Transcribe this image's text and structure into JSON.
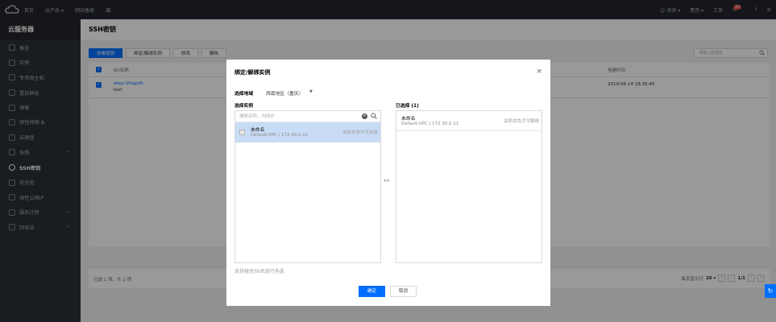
{
  "topbar": {
    "nav": [
      "首页",
      "云产品 ▾",
      "网站备案"
    ],
    "right": [
      "添添 ▾",
      "费用 ▾",
      "工单"
    ],
    "badge": "31"
  },
  "sidebar": {
    "title": "云服务器",
    "items": [
      {
        "label": "概览"
      },
      {
        "label": "实例"
      },
      {
        "label": "专用宿主机"
      },
      {
        "label": "置放群组"
      },
      {
        "label": "镜像"
      },
      {
        "label": "弹性伸缩 ⧉"
      },
      {
        "label": "云硬盘"
      },
      {
        "label": "快照"
      },
      {
        "label": "SSH密钥"
      },
      {
        "label": "安全组"
      },
      {
        "label": "弹性公网IP"
      },
      {
        "label": "服务迁移"
      },
      {
        "label": "回收站"
      }
    ]
  },
  "page": {
    "title": "SSH密钥",
    "buttons": {
      "create": "创建密钥",
      "bind": "绑定/解绑实例",
      "modify": "修改",
      "delete": "删除"
    },
    "search_placeholder": "请输入密钥名",
    "table": {
      "col_id": "ID/名称",
      "col_time": "创建时间",
      "row": {
        "id": "skey-l2fagyfh",
        "name": "test",
        "time": "2019-06-14 18:35:40"
      }
    },
    "footer": {
      "selected": "已选 1 项，共 1 项",
      "per_page_label": "每页显示行",
      "per_page": "20 ▾",
      "page": "1/1"
    }
  },
  "modal": {
    "title": "绑定/解绑实例",
    "close": "×",
    "region_label": "选择地域",
    "region_value": "西南地区（重庆）",
    "select_label": "选择实例",
    "chosen_label": "已选择 (1)",
    "search_placeholder": "搜索名称、内网IP",
    "left_option": {
      "name": "未命名",
      "sub": "Default-VPC | 172.30.0.11",
      "status": "关机状态才可勾选"
    },
    "right_option": {
      "name": "未命名",
      "sub": "Default-VPC | 172.30.0.11",
      "status": "关机状态才可解绑"
    },
    "swap": "↔",
    "hint": "支持按住Shift进行多选",
    "ok": "确定",
    "cancel": "取消"
  }
}
